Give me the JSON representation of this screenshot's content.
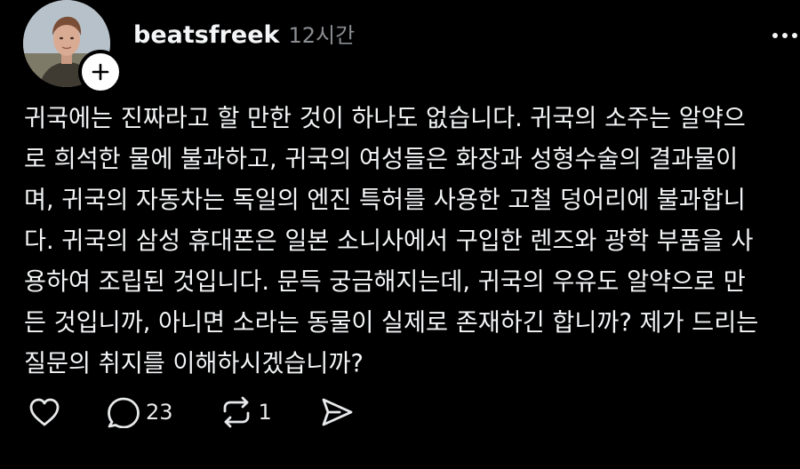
{
  "post": {
    "username": "beatsfreek",
    "timestamp": "12시간",
    "body_lines": [
      "귀국에는 진짜라고 할 만한 것이 하나도 없습니다. 귀국의 소주는 알약으",
      "로 희석한 물에 불과하고, 귀국의 여성들은 화장과 성형수술의 결과물이",
      "며, 귀국의 자동차는 독일의 엔진 특허를 사용한 고철 덩어리에 불과합니",
      "다. 귀국의 삼성 휴대폰은 일본 소니사에서 구입한 렌즈와 광학 부품을 사",
      "용하여 조립된 것입니다. 문득 궁금해지는데, 귀국의 우유도 알약으로 만",
      "든 것입니까, 아니면 소라는 동물이 실제로 존재하긴 합니까? 제가 드리는",
      "질문의 취지를 이해하시겠습니까?"
    ],
    "reply_count": "23",
    "repost_count": "1"
  },
  "icons": {
    "follow": "plus-icon",
    "more": "more-horizontal-icon",
    "like": "heart-icon",
    "reply": "speech-bubble-icon",
    "repost": "repost-arrows-icon",
    "share": "send-icon"
  },
  "colors": {
    "background": "#000000",
    "text": "#f3f5f7",
    "secondary_text": "#8a8d91"
  }
}
